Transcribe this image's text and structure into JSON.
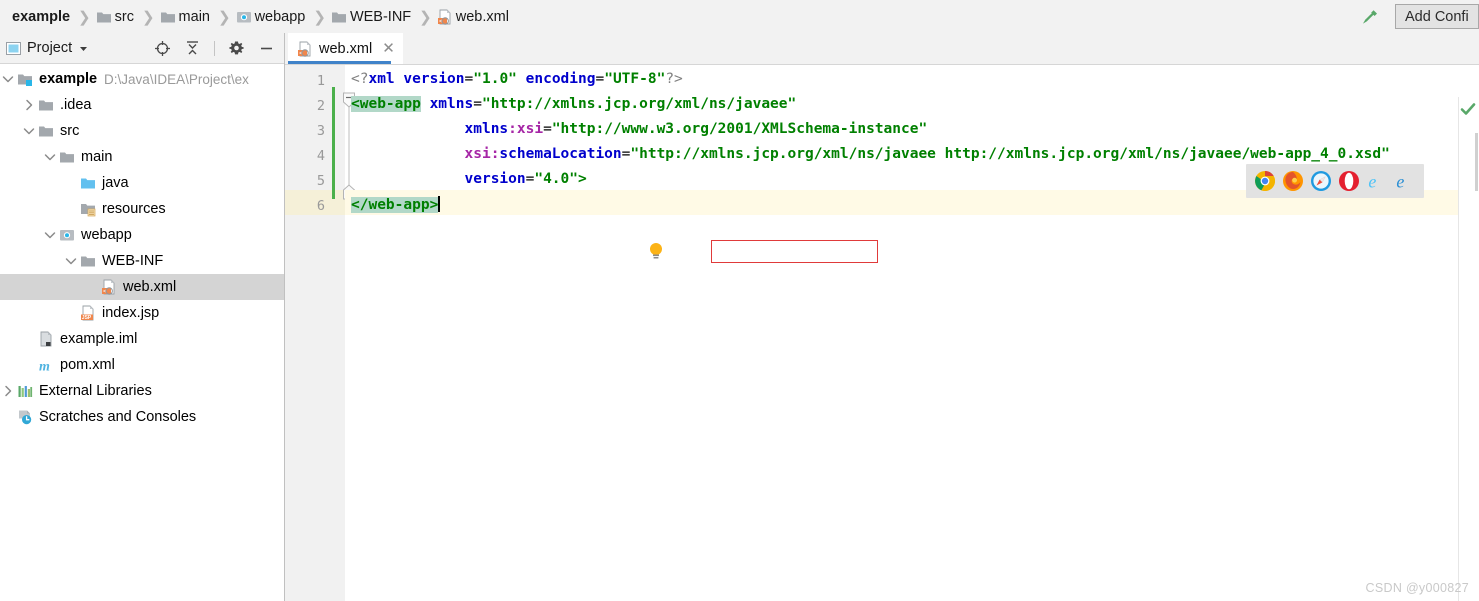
{
  "window": {
    "breadcrumb": [
      {
        "label": "example",
        "icon": "project-icon",
        "root": true
      },
      {
        "label": "src",
        "icon": "folder-icon"
      },
      {
        "label": "main",
        "icon": "folder-icon"
      },
      {
        "label": "webapp",
        "icon": "webapp-folder-icon"
      },
      {
        "label": "WEB-INF",
        "icon": "folder-icon"
      },
      {
        "label": "web.xml",
        "icon": "xml-file-icon"
      }
    ],
    "separator": "❯",
    "build_icon": "hammer-icon",
    "add_configuration_label": "Add Confi"
  },
  "sidebar": {
    "title": "Project",
    "title_icon": "project-view-icon",
    "dropdown_icon": "chevron-down-icon",
    "tools": [
      {
        "name": "locate-icon",
        "glyph": "target"
      },
      {
        "name": "collapse-all-icon",
        "glyph": "collapse"
      },
      {
        "name": "settings-gear-icon",
        "glyph": "gear"
      },
      {
        "name": "hide-window-icon",
        "glyph": "minus"
      }
    ],
    "tree": [
      {
        "label": "example",
        "path": "D:\\Java\\IDEA\\Project\\ex",
        "indent": 0,
        "arrow": "down",
        "icon": "module-icon",
        "bold": true,
        "selected": false
      },
      {
        "label": ".idea",
        "path": "",
        "indent": 1,
        "arrow": "right",
        "icon": "folder-icon",
        "bold": false,
        "selected": false
      },
      {
        "label": "src",
        "path": "",
        "indent": 1,
        "arrow": "down",
        "icon": "folder-icon",
        "bold": false,
        "selected": false
      },
      {
        "label": "main",
        "path": "",
        "indent": 2,
        "arrow": "down",
        "icon": "folder-icon",
        "bold": false,
        "selected": false
      },
      {
        "label": "java",
        "path": "",
        "indent": 3,
        "arrow": "none",
        "icon": "source-root-folder-icon",
        "bold": false,
        "selected": false
      },
      {
        "label": "resources",
        "path": "",
        "indent": 3,
        "arrow": "none",
        "icon": "resource-root-folder-icon",
        "bold": false,
        "selected": false
      },
      {
        "label": "webapp",
        "path": "",
        "indent": 2,
        "arrow": "down",
        "icon": "webapp-folder-icon",
        "bold": false,
        "selected": false
      },
      {
        "label": "WEB-INF",
        "path": "",
        "indent": 3,
        "arrow": "down",
        "icon": "folder-icon",
        "bold": false,
        "selected": false
      },
      {
        "label": "web.xml",
        "path": "",
        "indent": 4,
        "arrow": "none",
        "icon": "xml-file-icon",
        "bold": false,
        "selected": true
      },
      {
        "label": "index.jsp",
        "path": "",
        "indent": 3,
        "arrow": "none",
        "icon": "jsp-file-icon",
        "bold": false,
        "selected": false
      },
      {
        "label": "example.iml",
        "path": "",
        "indent": 1,
        "arrow": "none",
        "icon": "iml-file-icon",
        "bold": false,
        "selected": false
      },
      {
        "label": "pom.xml",
        "path": "",
        "indent": 1,
        "arrow": "none",
        "icon": "maven-file-icon",
        "bold": false,
        "selected": false
      },
      {
        "label": "External Libraries",
        "path": "",
        "indent": 0,
        "arrow": "right",
        "icon": "libraries-icon",
        "bold": false,
        "selected": false
      },
      {
        "label": "Scratches and Consoles",
        "path": "",
        "indent": 0,
        "arrow": "none",
        "icon": "scratches-icon",
        "bold": false,
        "selected": false
      }
    ]
  },
  "editor": {
    "tab": {
      "label": "web.xml",
      "icon": "xml-file-icon",
      "close_icon": "close-icon"
    },
    "line_numbers": [
      "1",
      "2",
      "3",
      "4",
      "5",
      "6"
    ],
    "inspection_status_icon": "checkmark-ok-icon",
    "gutter_hint_icon": "intention-bulb-icon",
    "code_lines": [
      {
        "number": "1",
        "segments": [
          {
            "t": "<?",
            "c": "k-pi"
          },
          {
            "t": "xml",
            "c": "k-attr"
          },
          {
            "t": " ",
            "c": "k-eq"
          },
          {
            "t": "version",
            "c": "k-attr"
          },
          {
            "t": "=",
            "c": "k-eq"
          },
          {
            "t": "\"1.0\"",
            "c": "k-val"
          },
          {
            "t": " ",
            "c": "k-eq"
          },
          {
            "t": "encoding",
            "c": "k-attr"
          },
          {
            "t": "=",
            "c": "k-eq"
          },
          {
            "t": "\"UTF-8\"",
            "c": "k-val"
          },
          {
            "t": "?>",
            "c": "k-pi"
          }
        ]
      },
      {
        "number": "2",
        "segments": [
          {
            "t": "<web-app",
            "c": "k-tag hl-tag"
          },
          {
            "t": " ",
            "c": "k-eq"
          },
          {
            "t": "xmlns",
            "c": "k-attr"
          },
          {
            "t": "=",
            "c": "k-eq"
          },
          {
            "t": "\"http://xmlns.jcp.org/xml/ns/javaee\"",
            "c": "k-val"
          }
        ]
      },
      {
        "number": "3",
        "segments": [
          {
            "t": "             ",
            "c": "k-eq"
          },
          {
            "t": "xmlns",
            "c": "k-attr"
          },
          {
            "t": ":xsi",
            "c": "k-ns"
          },
          {
            "t": "=",
            "c": "k-eq"
          },
          {
            "t": "\"http://www.w3.org/2001/XMLSchema-instance\"",
            "c": "k-val"
          }
        ]
      },
      {
        "number": "4",
        "segments": [
          {
            "t": "             ",
            "c": "k-eq"
          },
          {
            "t": "xsi:",
            "c": "k-ns"
          },
          {
            "t": "schemaLocation",
            "c": "k-attr"
          },
          {
            "t": "=",
            "c": "k-eq"
          },
          {
            "t": "\"http://xmlns.jcp.org/xml/ns/javaee http://xmlns.jcp.org/xml/ns/javaee/web-app_4_0.xsd\"",
            "c": "k-val"
          }
        ]
      },
      {
        "number": "5",
        "segments": [
          {
            "t": "             ",
            "c": "k-eq"
          },
          {
            "t": "version",
            "c": "k-attr"
          },
          {
            "t": "=",
            "c": "k-eq"
          },
          {
            "t": "\"4.0\"",
            "c": "k-val"
          },
          {
            "t": ">",
            "c": "k-tag"
          }
        ]
      },
      {
        "number": "6",
        "segments": [
          {
            "t": "</web-app>",
            "c": "k-tag hl-tag"
          }
        ]
      }
    ],
    "browser_bar": [
      {
        "name": "chrome-icon"
      },
      {
        "name": "firefox-icon"
      },
      {
        "name": "safari-icon"
      },
      {
        "name": "opera-icon"
      },
      {
        "name": "internet-explorer-icon"
      },
      {
        "name": "edge-icon"
      }
    ]
  },
  "watermark": "CSDN @y000827",
  "colors": {
    "accent": "#4083c9",
    "tag": "#008000",
    "attribute": "#0000cc",
    "namespace": "#a626a6",
    "error_box": "#e03a3a",
    "current_line": "#fffae6",
    "selection": "#d4d4d4"
  }
}
